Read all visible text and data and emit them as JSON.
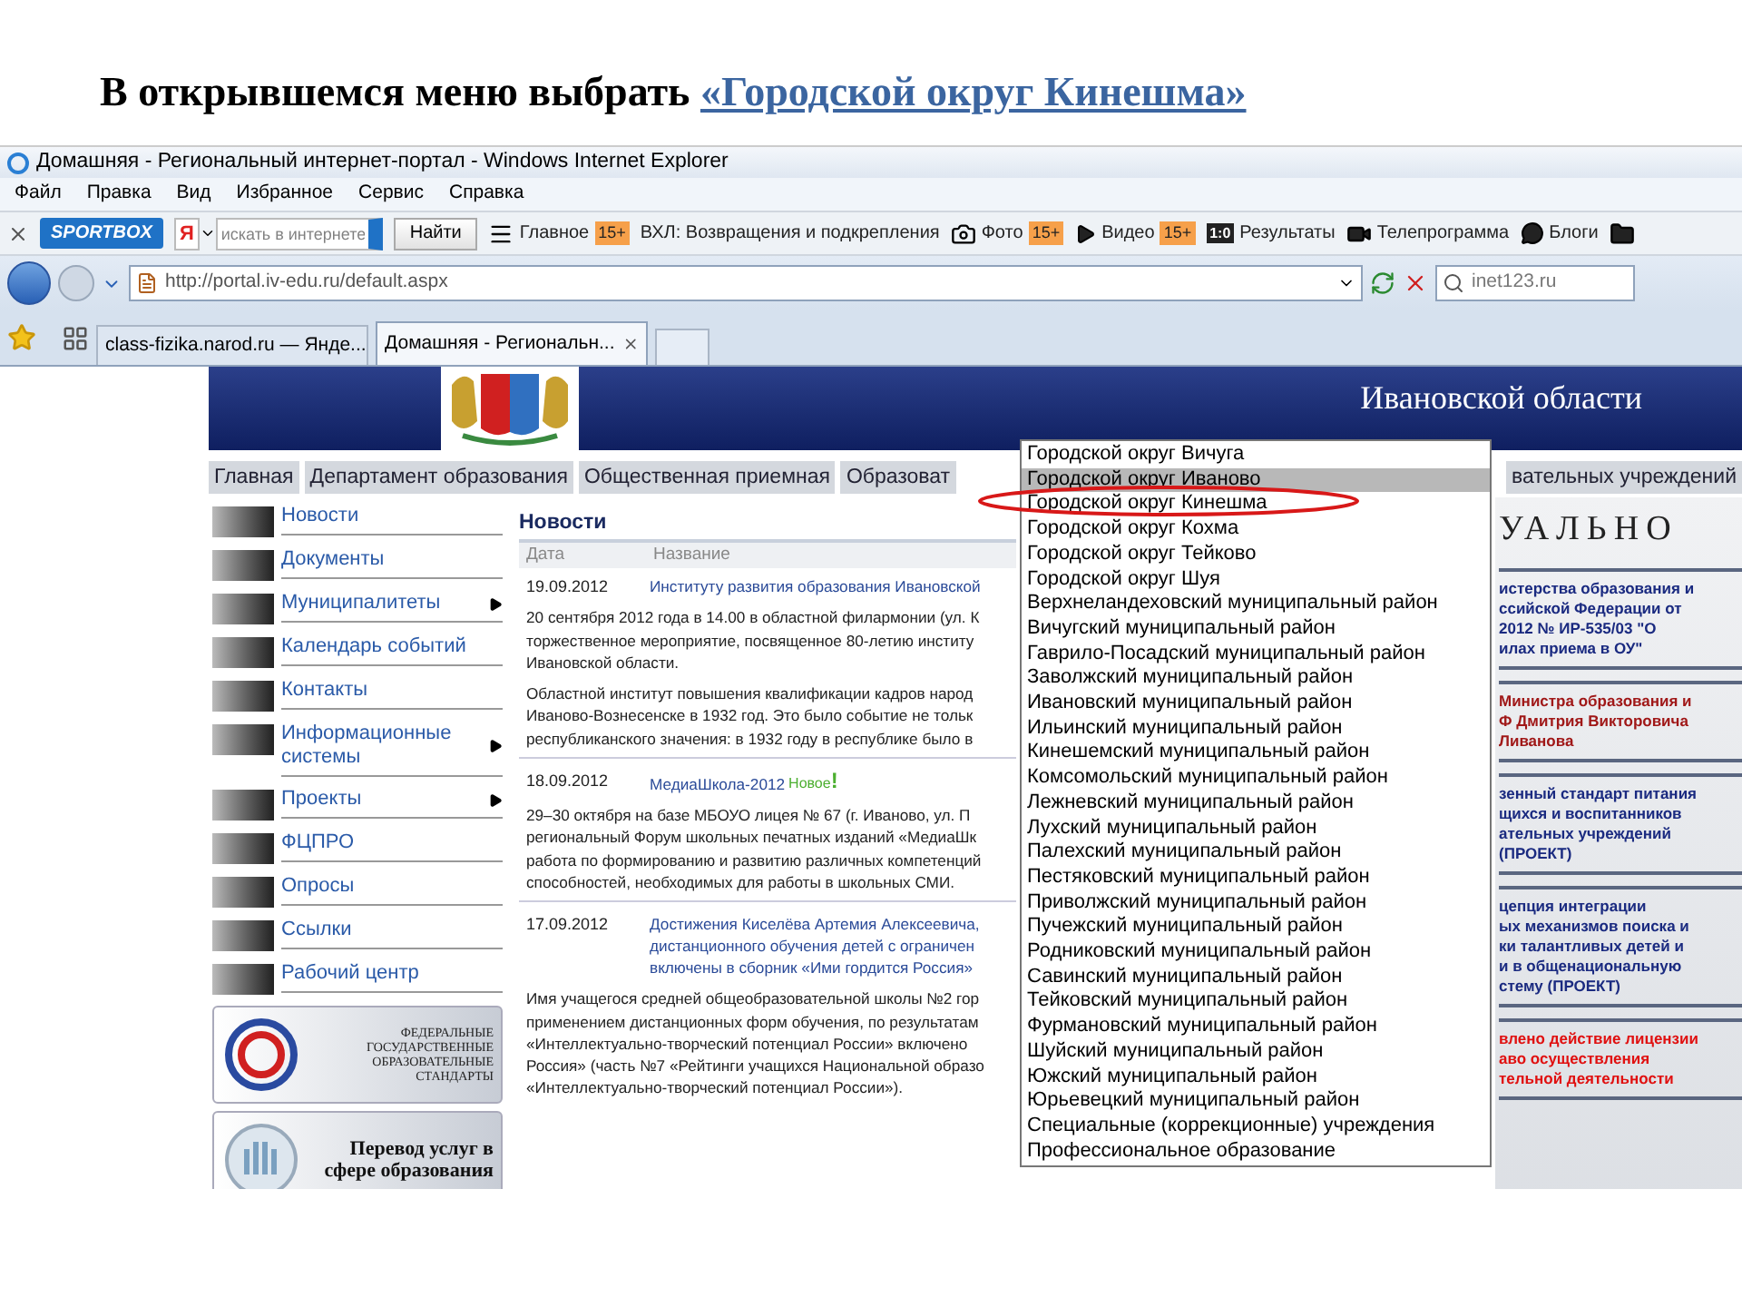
{
  "instruction": {
    "text": "В открывшемся меню выбрать",
    "link": "«Городской округ Кинешма»"
  },
  "window": {
    "title": "Домашняя - Региональный интернет-портал - Windows Internet Explorer"
  },
  "menu_bar": [
    "Файл",
    "Правка",
    "Вид",
    "Избранное",
    "Сервис",
    "Справка"
  ],
  "toolbar": {
    "brand": "SPORTBOX",
    "search": {
      "logo": "Я",
      "placeholder": "искать в интернете",
      "button": "Найти"
    },
    "items": [
      {
        "kind": "menu",
        "label": "Главное",
        "badge": "15+"
      },
      {
        "kind": "text",
        "label": "ВХЛ: Возвращения и подкрепления"
      },
      {
        "kind": "camera",
        "label": "Фото",
        "badge": "15+"
      },
      {
        "kind": "play",
        "label": "Видео",
        "badge": "15+"
      },
      {
        "kind": "score",
        "icon_text": "1:0",
        "label": "Результаты"
      },
      {
        "kind": "video",
        "label": "Телепрограмма"
      },
      {
        "kind": "chat",
        "label": "Блоги"
      },
      {
        "kind": "folder"
      }
    ]
  },
  "address_bar": {
    "url": "http://portal.iv-edu.ru/default.aspx",
    "search_value": "inet123.ru"
  },
  "tabs": [
    {
      "label": "class-fizika.narod.ru — Янде...",
      "selected": false
    },
    {
      "label": "Домашняя - Региональн...",
      "selected": true
    }
  ],
  "site": {
    "header_title": "Ивановской области",
    "nav": [
      "Главная",
      "Департамент образования",
      "Общественная приемная",
      "Образоват"
    ],
    "nav_tail": "вательных учреждений",
    "sidebar": [
      {
        "label": "Новости",
        "has_submenu": false
      },
      {
        "label": "Документы",
        "has_submenu": false
      },
      {
        "label": "Муниципалитеты",
        "has_submenu": true
      },
      {
        "label": "Календарь событий",
        "has_submenu": false
      },
      {
        "label": "Контакты",
        "has_submenu": false
      },
      {
        "label": "Информационные системы",
        "has_submenu": true
      },
      {
        "label": "Проекты",
        "has_submenu": true
      },
      {
        "label": "ФЦПРО",
        "has_submenu": false
      },
      {
        "label": "Опросы",
        "has_submenu": false
      },
      {
        "label": "Ссылки",
        "has_submenu": false
      },
      {
        "label": "Рабочий центр",
        "has_submenu": false
      }
    ],
    "banners": [
      {
        "kind": "standards",
        "text": "ФЕДЕРАЛЬНЫЕ ГОСУДАРСТВЕННЫЕ ОБРАЗОВАТЕЛЬНЫЕ СТАНДАРТЫ"
      },
      {
        "kind": "services",
        "text": "Перевод услуг в сфере образования"
      }
    ],
    "news": {
      "title": "Новости",
      "columns": [
        "Дата",
        "Название"
      ],
      "entries": [
        {
          "date": "19.09.2012",
          "title": [
            "Институту развития образования Ивановской"
          ],
          "paragraphs": [
            [
              "20 сентября 2012 года в 14.00 в областной филармонии (ул. К",
              "торжественное мероприятие, посвященное 80-летию институ",
              "Ивановской области."
            ],
            [
              "Областной институт повышения квалификации кадров народ",
              "Иваново-Вознесенске в 1932 год. Это было событие не тольк",
              "республиканского значения: в 1932 году в республике было в"
            ]
          ]
        },
        {
          "date": "18.09.2012",
          "title": [
            "МедиаШкола-2012"
          ],
          "badge": "Новое",
          "badge_mark": "!",
          "paragraphs": [
            [
              "29–30 октября на базе МБОУО лицея № 67 (г. Иваново, ул. П",
              "региональный Форум школьных печатных изданий «МедиаШк",
              "работа по формированию и развитию различных компетенций",
              "способностей, необходимых для работы в школьных СМИ."
            ]
          ]
        },
        {
          "date": "17.09.2012",
          "title": [
            "Достижения Киселёва Артемия Алексеевича,",
            "дистанционного обучения детей с ограничен",
            "включены в сборник «Ими гордится Россия»"
          ],
          "paragraphs": [
            [
              "Имя учащегося средней общеобразовательной школы №2 гор",
              "применением дистанционных форм обучения, по результатам",
              "«Интеллектуально-творческий потенциал России» включено",
              "Россия» (часть №7 «Рейтинги учащихся Национальной образо",
              "«Интеллектуально-творческий потенциал России»)."
            ]
          ]
        }
      ]
    },
    "right_column": {
      "heading": "УАЛЬНО",
      "notices": [
        {
          "lines": [
            "истерства образования и",
            "ссийской Федерации от",
            "2012 № ИР-535/03 \"О",
            "илах приема в ОУ\""
          ],
          "color": "#1a2a80"
        },
        {
          "lines": [
            "Министра образования и",
            "Ф Дмитрия Викторовича",
            "Ливанова"
          ],
          "color": "#a01818"
        },
        {
          "lines": [
            "зенный стандарт питания",
            "щихся и воспитанников",
            "ательных учреждений",
            "(ПРОЕКТ)"
          ],
          "color": "#1a2a80"
        },
        {
          "lines": [
            "цепция интеграции",
            "ых механизмов поиска и",
            "ки талантливых детей и",
            "и в общенациональную",
            "стему (ПРОЕКТ)"
          ],
          "color": "#1a2a80"
        },
        {
          "lines": [
            "влено действие лицензии",
            "аво осуществления",
            "тельной деятельности"
          ],
          "color": "#e01010"
        }
      ]
    },
    "dropdown": {
      "items": [
        {
          "label": "Городской округ Вичуга",
          "selected": false
        },
        {
          "label": "Городской округ Иваново",
          "selected": true
        },
        {
          "label": "Городской округ Кинешма",
          "selected": false
        },
        {
          "label": "Городской округ Кохма",
          "selected": false
        },
        {
          "label": "Городской округ Тейково",
          "selected": false
        },
        {
          "label": "Городской округ Шуя",
          "selected": false
        },
        {
          "label": "Верхнеландеховский муниципальный район",
          "selected": false
        },
        {
          "label": "Вичугский муниципальный район",
          "selected": false
        },
        {
          "label": "Гаврило-Посадский муниципальный район",
          "selected": false
        },
        {
          "label": "Заволжский муниципальный район",
          "selected": false
        },
        {
          "label": "Ивановский муниципальный район",
          "selected": false
        },
        {
          "label": "Ильинский муниципальный район",
          "selected": false
        },
        {
          "label": "Кинешемский муниципальный район",
          "selected": false
        },
        {
          "label": "Комсомольский муниципальный район",
          "selected": false
        },
        {
          "label": "Лежневский муниципальный район",
          "selected": false
        },
        {
          "label": "Лухский муниципальный район",
          "selected": false
        },
        {
          "label": "Палехский муниципальный район",
          "selected": false
        },
        {
          "label": "Пестяковский муниципальный район",
          "selected": false
        },
        {
          "label": "Приволжский муниципальный район",
          "selected": false
        },
        {
          "label": "Пучежский муниципальный район",
          "selected": false
        },
        {
          "label": "Родниковский муниципальный район",
          "selected": false
        },
        {
          "label": "Савинский муниципальный район",
          "selected": false
        },
        {
          "label": "Тейковский муниципальный район",
          "selected": false
        },
        {
          "label": "Фурмановский муниципальный район",
          "selected": false
        },
        {
          "label": "Шуйский муниципальный район",
          "selected": false
        },
        {
          "label": "Южский муниципальный район",
          "selected": false
        },
        {
          "label": "Юрьевецкий муниципальный район",
          "selected": false
        },
        {
          "label": "Специальные (коррекционные) учреждения",
          "selected": false
        },
        {
          "label": "Профессиональное образование",
          "selected": false
        }
      ]
    }
  }
}
